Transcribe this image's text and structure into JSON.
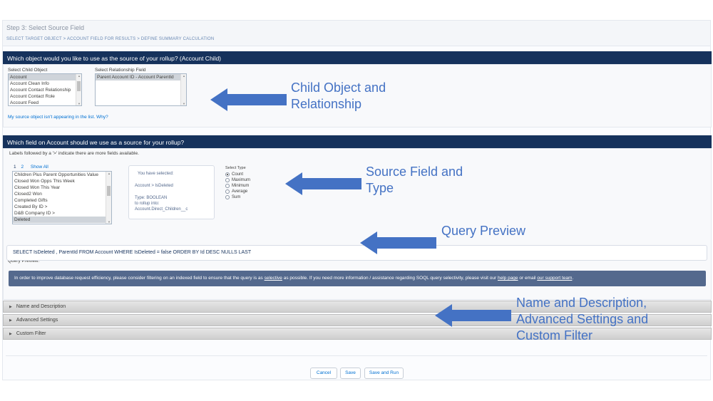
{
  "step": {
    "title": "Step 3: Select Source Field",
    "breadcrumb": "SELECT TARGET OBJECT > ACCOUNT FIELD FOR RESULTS > DEFINE SUMMARY CALCULATION"
  },
  "child_section": {
    "heading": "Which object would you like to use as the source of your rollup? (Account Child)",
    "child_label": "Select Child Object",
    "child_options": [
      "Account",
      "Account Clean Info",
      "Account Contact Relationship",
      "Account Contact Role",
      "Account Feed"
    ],
    "relationship_label": "Select Relationship Field",
    "relationship_options": [
      "Parent Account ID - Account ParentId"
    ],
    "missing_link": "My source object isn't appearing in the list. Why?"
  },
  "source_section": {
    "heading": "Which field on Account should we use as a source for your rollup?",
    "hint": "Labels followed by a '>' indicate there are more fields available.",
    "pages": [
      "1",
      "2",
      "Show All"
    ],
    "field_options": [
      "Children Plus Parent Opportunities Value",
      "Closed Won Opps This Week",
      "Closed Won This Year",
      "Closed2 Won",
      "Completed Gifts",
      "Created By ID >",
      "D&B Company ID >",
      "Deleted"
    ],
    "selected_heading": "You have selected:",
    "selected_path": "Account > IsDeleted",
    "selected_type": "Type: BOOLEAN",
    "selected_rollup": "to rollup into:",
    "selected_target": "Account.Direct_Children__c",
    "type_label": "Select Type",
    "types": [
      "Count",
      "Maximum",
      "Minimum",
      "Average",
      "Sum"
    ],
    "query_label": "Query Preview:",
    "query": "SELECT IsDeleted , ParentId FROM Account WHERE IsDeleted = false ORDER BY Id DESC NULLS LAST",
    "banner_text": "In order to improve database request efficiency, please consider filtering on an indexed field to ensure that the query is as",
    "banner_selective": "selective",
    "banner_text2": "as possible. If you need more information / assistance regarding SOQL query selectivity, please visit our",
    "banner_help": "help page",
    "banner_or": "or email",
    "banner_support": "our support team",
    "banner_end": "."
  },
  "accordions": [
    "Name and Description",
    "Advanced Settings",
    "Custom Filter"
  ],
  "buttons": {
    "cancel": "Cancel",
    "save": "Save",
    "save_run": "Save and Run"
  },
  "annotations": {
    "child": [
      "Child Object and",
      "Relationship"
    ],
    "source": [
      "Source Field and",
      "Type"
    ],
    "query": [
      "Query Preview"
    ],
    "name": [
      "Name and Description,",
      "Advanced Settings and",
      "Custom Filter"
    ]
  },
  "colors": {
    "section_bar": "#16325c",
    "annotation": "#4472c4",
    "banner": "#54698d",
    "link": "#0070d2"
  }
}
